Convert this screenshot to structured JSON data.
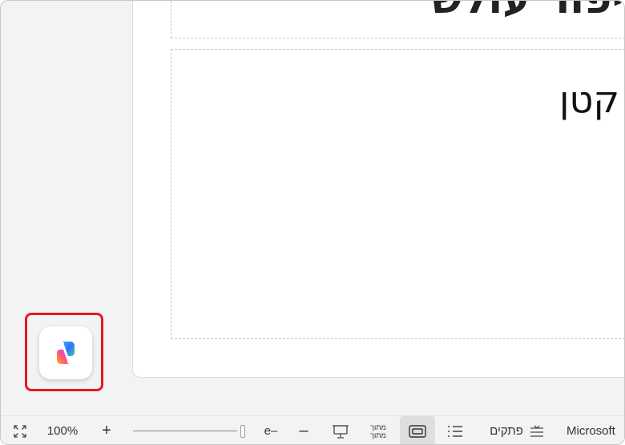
{
  "slide": {
    "title_text": "סיפור עולש",
    "body_text": "קטן"
  },
  "copilot": {
    "icon": "copilot-icon"
  },
  "statusbar": {
    "fullscreen_icon": "expand-icon",
    "zoom_level": "100%",
    "zoom_in": "+",
    "zoom_out": "–",
    "slider_label": "e–",
    "presenter_icon": "presentation-icon",
    "reading_view_label_1": "מתוך",
    "reading_view_label_2": "מתוך",
    "normal_view_icon": "normal-view-icon",
    "outline_icon": "list-icon",
    "notes_label": "פתקים",
    "notes_icon": "notes-icon",
    "app_name": "Microsoft"
  },
  "colors": {
    "highlight": "#e11d1d"
  }
}
